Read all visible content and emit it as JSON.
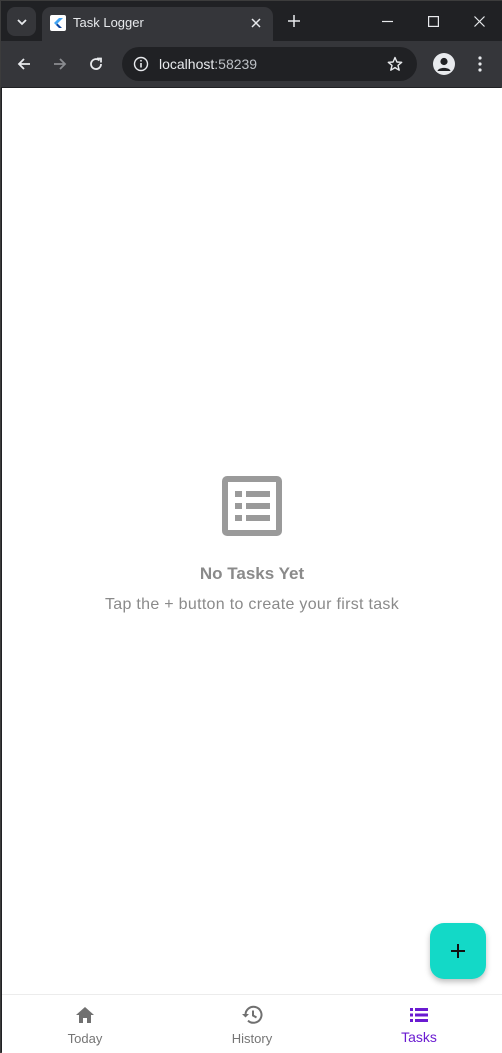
{
  "browser": {
    "tab_title": "Task Logger",
    "url_host": "localhost",
    "url_port": ":58239"
  },
  "empty_state": {
    "title": "No Tasks Yet",
    "subtitle": "Tap the + button to create your first task",
    "icon": "list-icon"
  },
  "fab": {
    "icon": "plus-icon"
  },
  "bottom_nav": {
    "items": [
      {
        "label": "Today",
        "icon": "home-icon",
        "active": false
      },
      {
        "label": "History",
        "icon": "history-icon",
        "active": false
      },
      {
        "label": "Tasks",
        "icon": "list-icon",
        "active": true
      }
    ]
  },
  "colors": {
    "accent": "#6a1bd1",
    "fab": "#13d9c7",
    "muted_text": "#8a8a8a"
  }
}
